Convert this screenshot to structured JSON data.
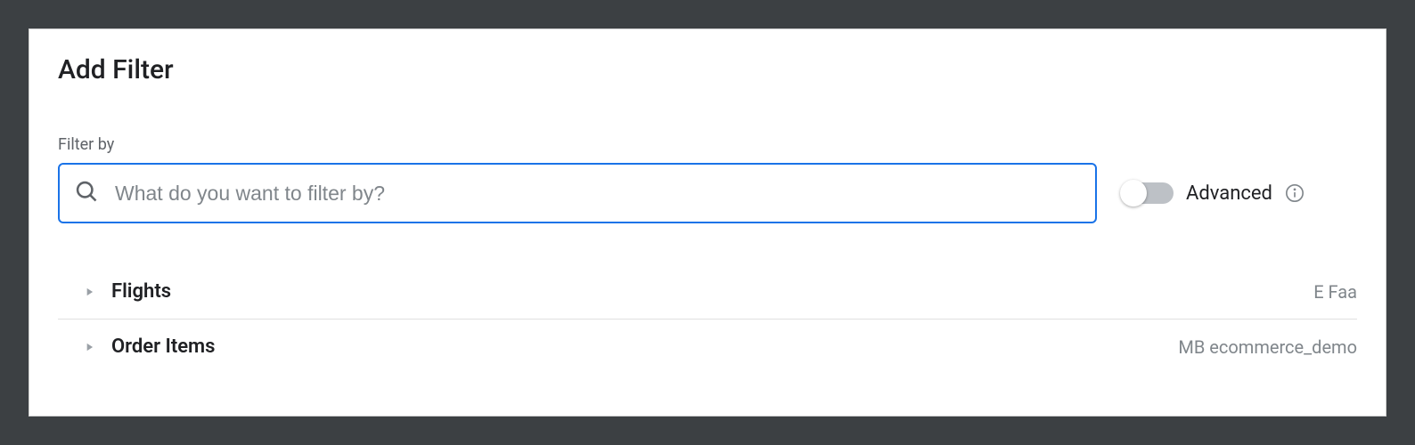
{
  "modal": {
    "title": "Add Filter"
  },
  "filter": {
    "label": "Filter by",
    "placeholder": "What do you want to filter by?",
    "value": ""
  },
  "advanced": {
    "label": "Advanced"
  },
  "items": [
    {
      "name": "Flights",
      "meta": "E Faa"
    },
    {
      "name": "Order Items",
      "meta": "MB ecommerce_demo"
    }
  ]
}
